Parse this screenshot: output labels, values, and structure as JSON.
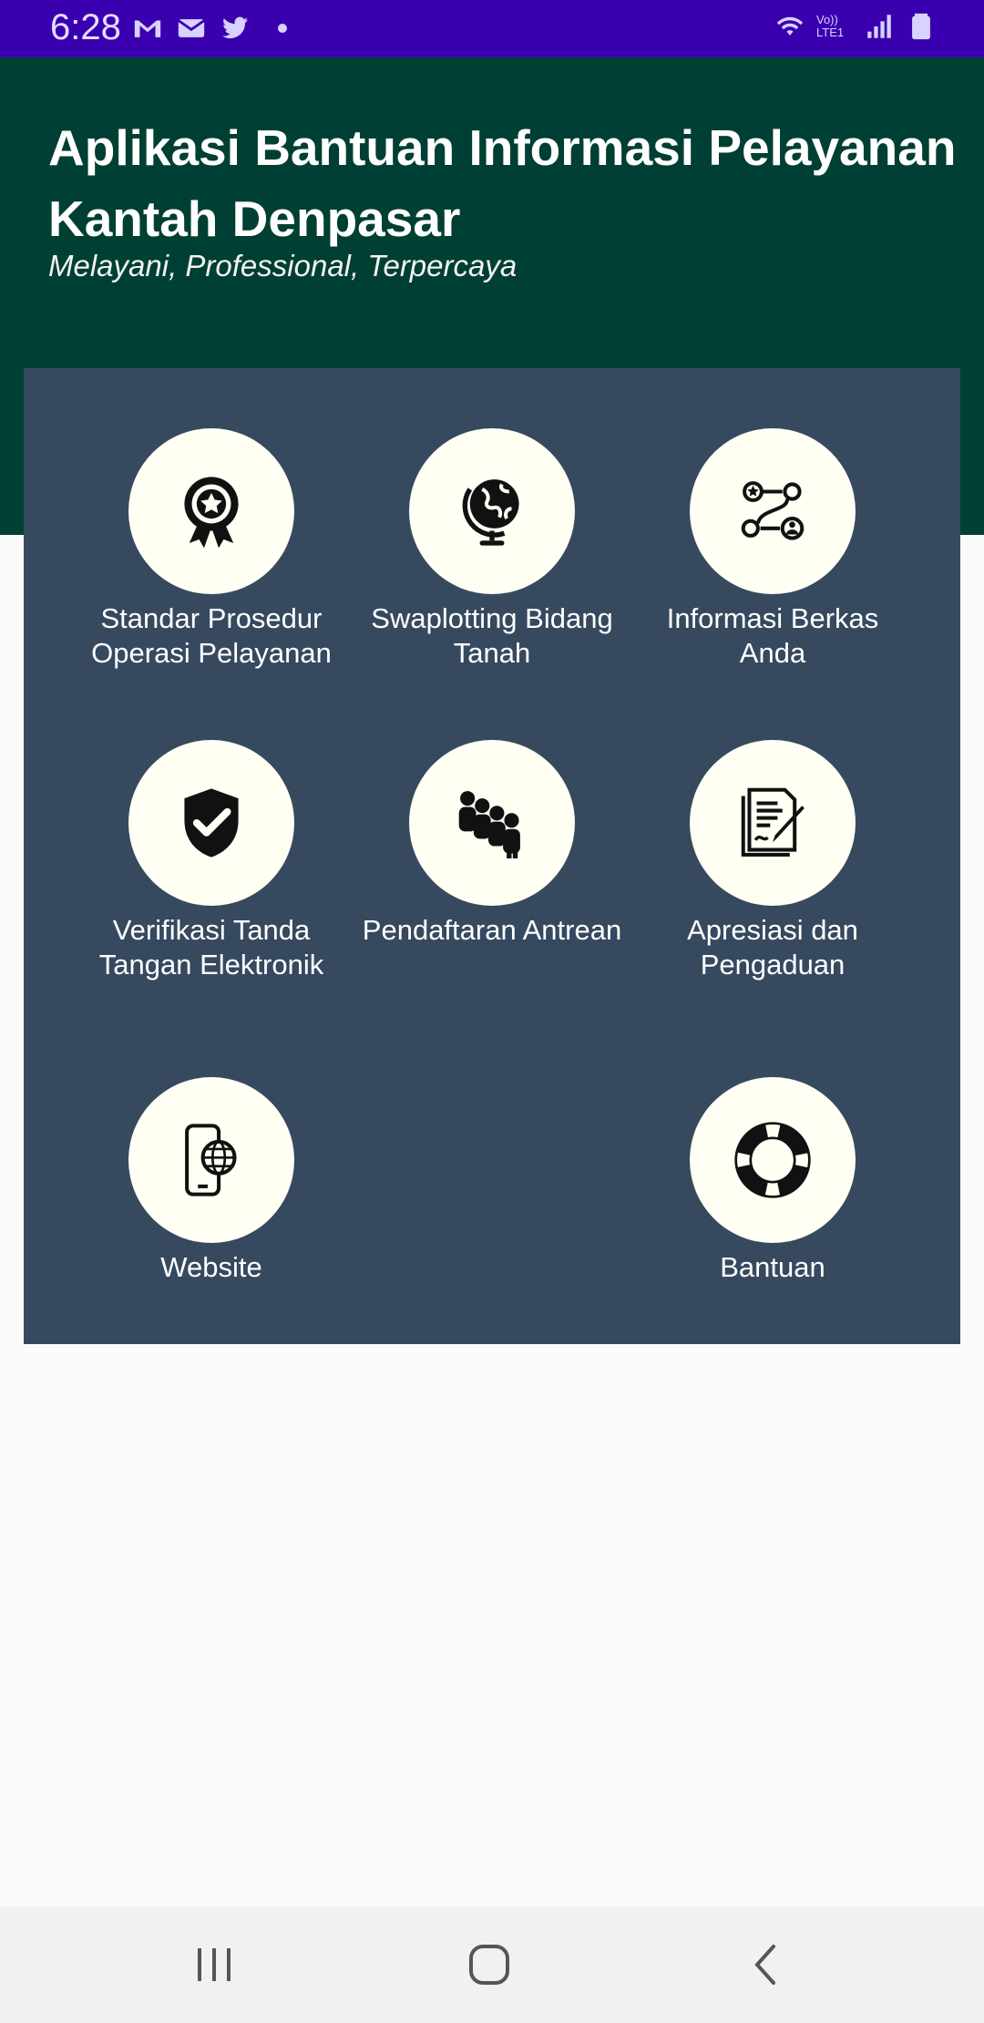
{
  "status_bar": {
    "time": "6:28",
    "left_icons": [
      "gmail-icon",
      "mail-icon",
      "twitter-icon",
      "dot-icon"
    ],
    "right_icons": [
      "wifi-icon",
      "volte-icon",
      "signal-icon",
      "battery-icon"
    ],
    "volte_text": "Vo)) LTE1"
  },
  "header": {
    "title": "Aplikasi Bantuan Informasi Pelayanan Kantah Denpasar",
    "subtitle": "Melayani, Professional, Terpercaya"
  },
  "menu": {
    "items": [
      {
        "label": "Standar Prosedur Operasi Pelayanan",
        "icon": "award-badge-icon"
      },
      {
        "label": "Swaplotting Bidang Tanah",
        "icon": "globe-icon"
      },
      {
        "label": "Informasi Berkas Anda",
        "icon": "gears-workflow-icon"
      },
      {
        "label": "Verifikasi Tanda Tangan Elektronik",
        "icon": "shield-check-icon"
      },
      {
        "label": "Pendaftaran Antrean",
        "icon": "people-queue-icon"
      },
      {
        "label": "Apresiasi dan Pengaduan",
        "icon": "document-sign-icon"
      },
      {
        "label": "Website",
        "icon": "phone-globe-icon"
      },
      {
        "label": "Bantuan",
        "icon": "lifebuoy-icon"
      }
    ]
  },
  "nav_bar": {
    "buttons": [
      "recent-apps-icon",
      "home-icon",
      "back-icon"
    ]
  },
  "colors": {
    "status_bar": "#3a00b0",
    "header": "#003f33",
    "panel": "#36495f",
    "circle": "#fffff3"
  }
}
